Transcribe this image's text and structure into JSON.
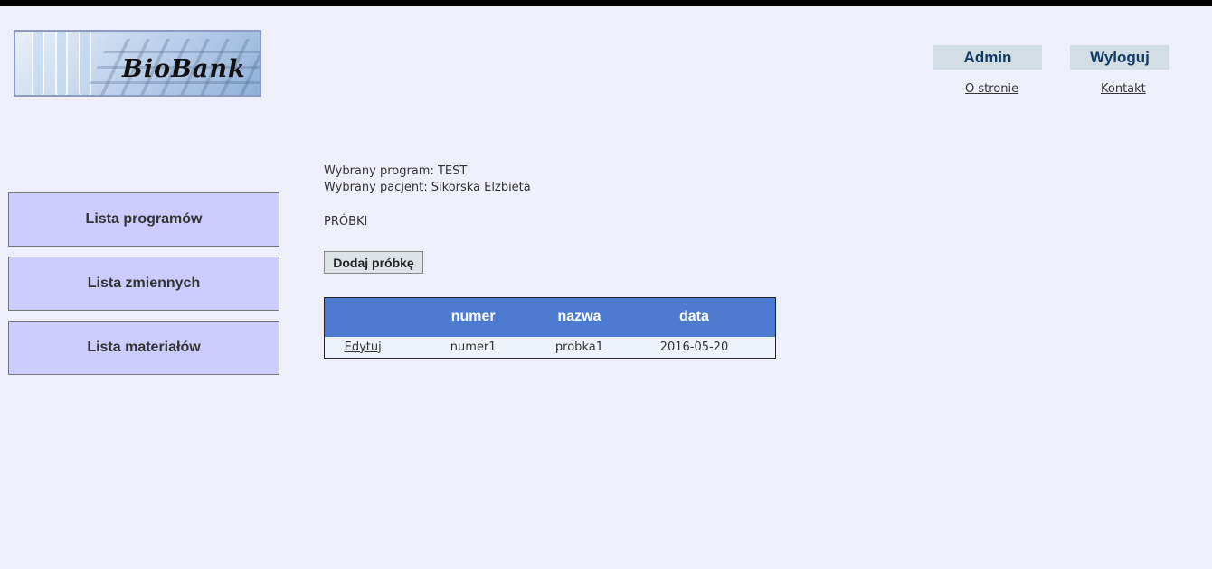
{
  "logo": {
    "text": "BioBank"
  },
  "header": {
    "admin_label": "Admin",
    "logout_label": "Wyloguj",
    "about_link": "O stronie",
    "contact_link": "Kontakt"
  },
  "nav": {
    "programs": "Lista programów",
    "variables": "Lista zmiennych",
    "materials": "Lista materiałów"
  },
  "main": {
    "selected_program": "Wybrany program: TEST",
    "selected_patient": "Wybrany pacjent: Sikorska Elzbieta",
    "section_title": "PRÓBKI",
    "add_button": "Dodaj próbkę",
    "table": {
      "headers": [
        "",
        "numer",
        "nazwa",
        "data"
      ],
      "rows": [
        {
          "action": "Edytuj",
          "numer": "numer1",
          "nazwa": "probka1",
          "data": "2016-05-20"
        }
      ]
    }
  },
  "colors": {
    "background": "#efeffc",
    "nav_button": "#ccccfe",
    "table_header": "#4d7bd1",
    "header_button": "#d3dde4"
  }
}
